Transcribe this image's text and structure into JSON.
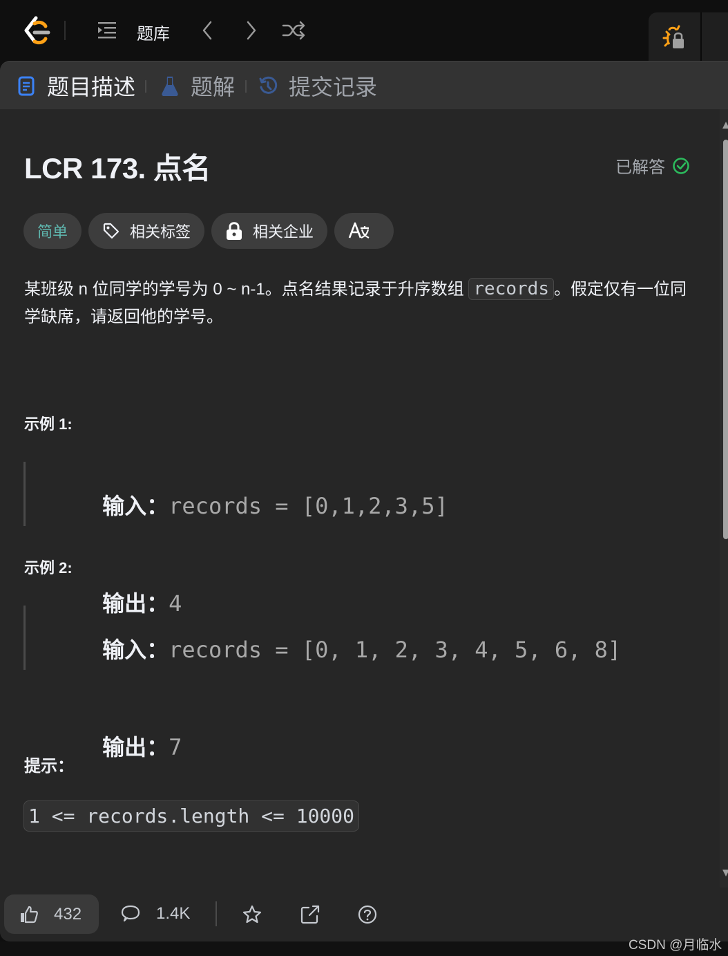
{
  "topnav": {
    "title": "题库",
    "icons": {
      "logo": "leetcode-logo",
      "list": "problem-list-icon",
      "prev": "chevron-left-icon",
      "next": "chevron-right-icon",
      "shuffle": "shuffle-icon",
      "debug": "bug-lock-icon"
    }
  },
  "tabs": [
    {
      "label": "题目描述",
      "icon": "document-icon",
      "active": true
    },
    {
      "label": "题解",
      "icon": "flask-icon",
      "active": false
    },
    {
      "label": "提交记录",
      "icon": "history-icon",
      "active": false
    }
  ],
  "problem": {
    "title": "LCR 173. 点名",
    "status": "已解答",
    "status_color": "#2cbb5d",
    "chips": {
      "difficulty": "简单",
      "difficulty_color": "#5fb8b0",
      "tags": "相关标签",
      "companies": "相关企业",
      "translate": "A文"
    },
    "description": {
      "part1": "某班级 n 位同学的学号为 0 ~ n-1。点名结果记录于升序数组 ",
      "code": "records",
      "part2": "。假定仅有一位同学缺席，请返回他的学号。"
    },
    "examples": [
      {
        "label": "示例 1:",
        "input_key": "输入：",
        "input_value": "records = [0,1,2,3,5]",
        "output_key": "输出：",
        "output_value": "4"
      },
      {
        "label": "示例 2:",
        "input_key": "输入：",
        "input_value": "records = [0, 1, 2, 3, 4, 5, 6, 8]",
        "output_key": "输出：",
        "output_value": "7"
      }
    ],
    "hint_label": "提示：",
    "constraint": "1 <= records.length <= 10000"
  },
  "footer": {
    "likes": "432",
    "comments": "1.4K"
  },
  "watermark": "CSDN @月临水"
}
